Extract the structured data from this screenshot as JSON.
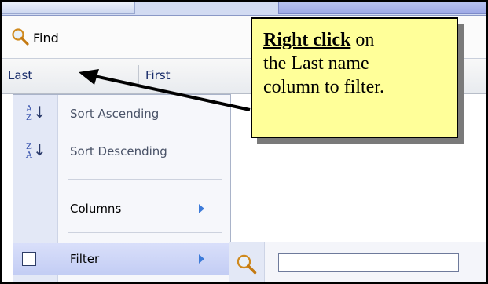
{
  "toolbar": {
    "find_label": "Find"
  },
  "columns": {
    "last": "Last",
    "first": "First"
  },
  "menu": {
    "sort_asc": "Sort Ascending",
    "sort_desc": "Sort Descending",
    "columns": "Columns",
    "filter": "Filter"
  },
  "filter_input": {
    "value": ""
  },
  "callout": {
    "emphasis": "Right click",
    "rest_line1": " on",
    "line2": "the Last name",
    "line3": "column to filter."
  },
  "icons": {
    "find": "magnifier-icon",
    "sort_asc": "sort-a-z-icon",
    "sort_desc": "sort-z-a-icon",
    "columns_submenu": "chevron-right-icon",
    "filter_submenu": "chevron-right-icon",
    "filter_search": "magnifier-icon"
  },
  "colors": {
    "accent": "#3d7bd9",
    "callout_bg": "#ffff99",
    "menu_highlight": "#c3cdf4"
  }
}
